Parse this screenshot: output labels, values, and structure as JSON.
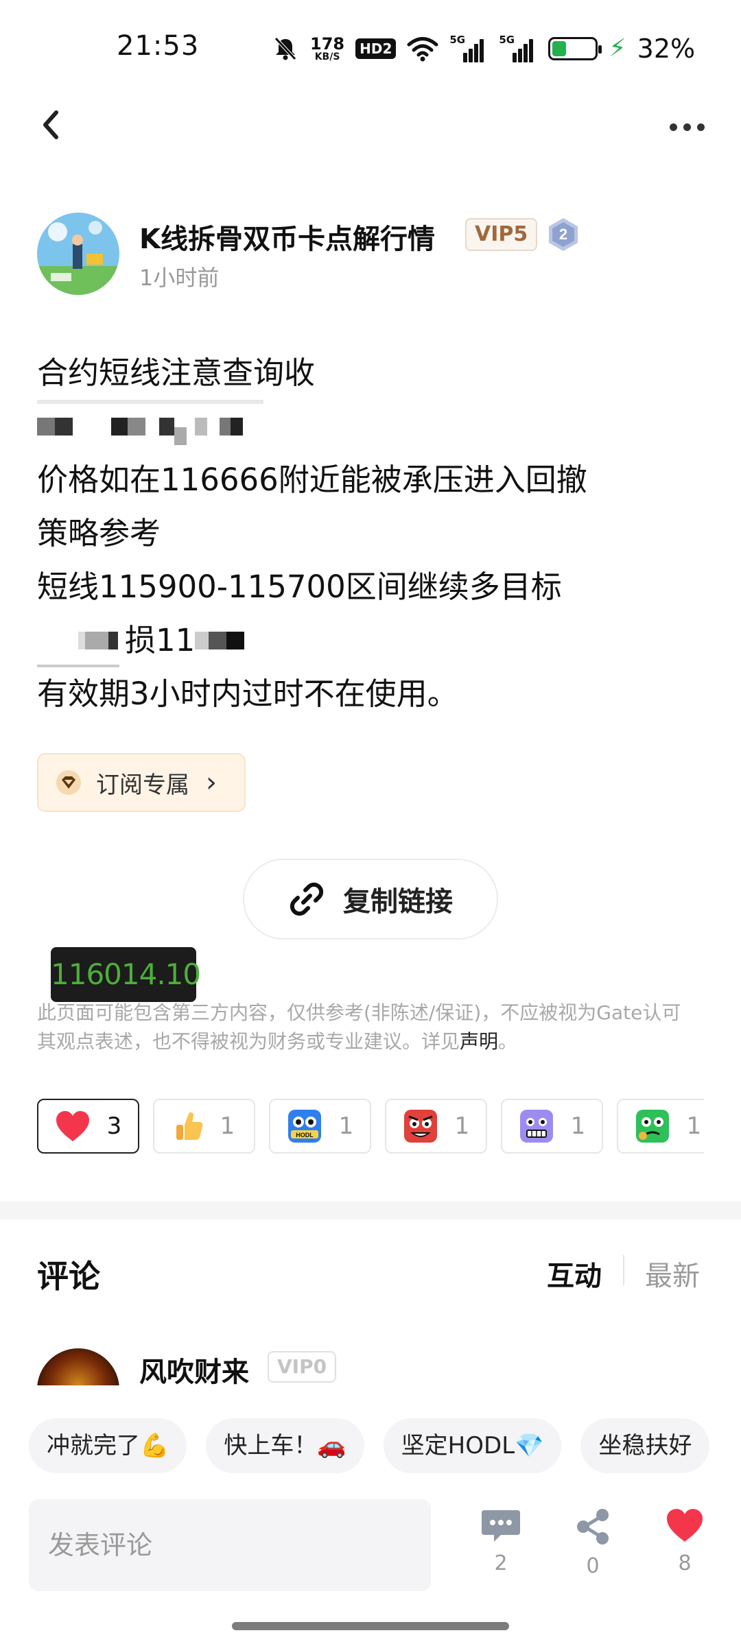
{
  "status_bar": {
    "time": "21:53",
    "net_speed_value": "178",
    "net_speed_unit": "KB/S",
    "hd_label": "HD2",
    "signal_1_label": "5G",
    "signal_2_label": "5G",
    "battery_percent": "32%",
    "battery_level": 0.32,
    "icons": [
      "mute-bell-icon",
      "wifi-icon",
      "signal-icon",
      "battery-icon",
      "charging-icon"
    ]
  },
  "nav": {
    "back_icon": "chevron-left-icon",
    "more_icon": "more-dots-icon"
  },
  "author": {
    "name": "K线拆骨双币卡点解行情",
    "vip": "VIP5",
    "level": "2",
    "time": "1小时前"
  },
  "post": {
    "line1": "合约短线注意查询收",
    "line3": "价格如在116666附近能被承压进入回撤",
    "line4": "策略参考",
    "line5": "短线115900-115700区间继续多目标",
    "line6_partial": "损11",
    "line7": "有效期3小时内过时不在使用。"
  },
  "subscription": {
    "label": "订阅专属"
  },
  "copy_link": {
    "label": "复制链接"
  },
  "price_tag": "116014.10",
  "disclaimer": {
    "text": "此页面可能包含第三方内容，仅供参考(非陈述/保证)，不应被视为Gate认可其观点表述，也不得被视为财务或专业建议。详见",
    "link": "声明",
    "end": "。"
  },
  "reactions": [
    {
      "icon": "heart-icon",
      "count": "3"
    },
    {
      "icon": "thumbs-up-icon",
      "count": "1"
    },
    {
      "icon": "hodl-emoji-icon",
      "count": "1",
      "badge": "HODL"
    },
    {
      "icon": "angry-emoji-icon",
      "count": "1"
    },
    {
      "icon": "grimace-emoji-icon",
      "count": "1"
    },
    {
      "icon": "sick-emoji-icon",
      "count": "1"
    }
  ],
  "comments": {
    "title": "评论",
    "tab_interact": "互动",
    "tab_latest": "最新",
    "first_commenter": {
      "name": "风吹财来",
      "vip": "VIP0"
    }
  },
  "quick_replies": [
    "冲就完了💪",
    "快上车！🚗",
    "坚定HODL💎",
    "坐稳扶好"
  ],
  "bottom_bar": {
    "input_placeholder": "发表评论",
    "comment_count": "2",
    "share_count": "0",
    "like_count": "8"
  },
  "colors": {
    "accent_green": "#22b14c",
    "price_green": "#4caf3a",
    "heart_red": "#f4364c",
    "vip_brown": "#a0693c",
    "sub_chip_bg": "#fff4e6"
  }
}
